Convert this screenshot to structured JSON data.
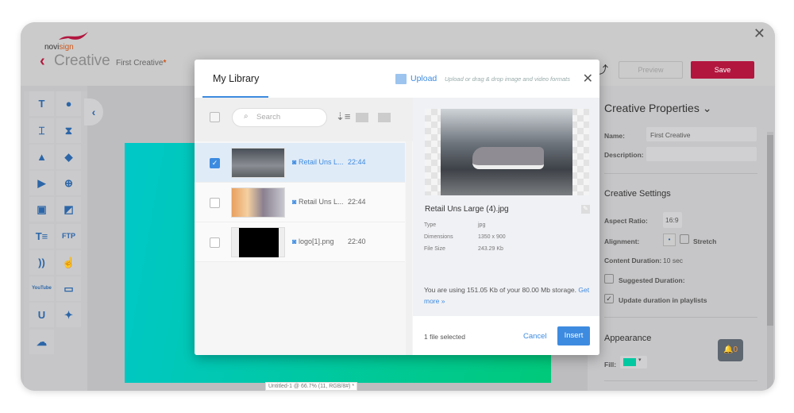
{
  "app": {
    "logo": "novisign",
    "title": "Creative",
    "creative_name": "First Creative",
    "unsaved_mark": "*",
    "preview_label": "Preview",
    "save_label": "Save"
  },
  "toolbar": {
    "tools": [
      "text-icon",
      "clock-icon",
      "text-box-icon",
      "hourglass-icon",
      "image-icon",
      "shapes-icon",
      "video-icon",
      "web-icon",
      "slideshow-icon",
      "web-image-icon",
      "text-list-icon",
      "FTP",
      "rss-icon",
      "touch-icon",
      "YouTube",
      "screen-icon",
      "U",
      "twitter-icon",
      "weather-icon"
    ]
  },
  "canvas": {
    "status": "Untitled-1 @ 66.7% (11, RGB/8#) *",
    "fill_gradient": [
      "#00c8c8",
      "#00c97a"
    ]
  },
  "modal": {
    "tab": "My Library",
    "upload_label": "Upload",
    "upload_hint": "Upload or drag & drop image and video formats",
    "search_placeholder": "Search",
    "files": [
      {
        "name": "Retail Uns L...",
        "time": "22:44",
        "selected": true
      },
      {
        "name": "Retail Uns L...",
        "time": "22:44",
        "selected": false
      },
      {
        "name": "logo[1].png",
        "time": "22:40",
        "selected": false
      }
    ],
    "detail": {
      "filename": "Retail Uns Large (4).jpg",
      "type_label": "Type",
      "type": "jpg",
      "dim_label": "Dimensions",
      "dimensions": "1350 x 900",
      "size_label": "File Size",
      "size": "243.29 Kb"
    },
    "storage_text": "You are using 151.05 Kb of your 80.00 Mb storage.",
    "storage_link": "Get more »",
    "footer": {
      "selected": "1 file selected",
      "cancel": "Cancel",
      "insert": "Insert"
    }
  },
  "properties": {
    "title": "Creative Properties",
    "name_label": "Name:",
    "name_value": "First Creative",
    "desc_label": "Description:",
    "desc_value": "",
    "settings_title": "Creative Settings",
    "aspect_label": "Aspect Ratio:",
    "aspect_value": "16:9",
    "alignment_label": "Alignment:",
    "stretch_label": "Stretch",
    "duration_label": "Content Duration:",
    "duration_value": "10 sec",
    "suggested_label": "Suggested Duration:",
    "suggested_checked": false,
    "update_label": "Update duration in playlists",
    "update_checked": true,
    "appearance_title": "Appearance",
    "fill_label": "Fill:",
    "fill_color": "#00c8a0"
  },
  "notifications": {
    "count": "0"
  },
  "colors": {
    "brand": "#b2163f",
    "accent": "#3d8be0"
  }
}
